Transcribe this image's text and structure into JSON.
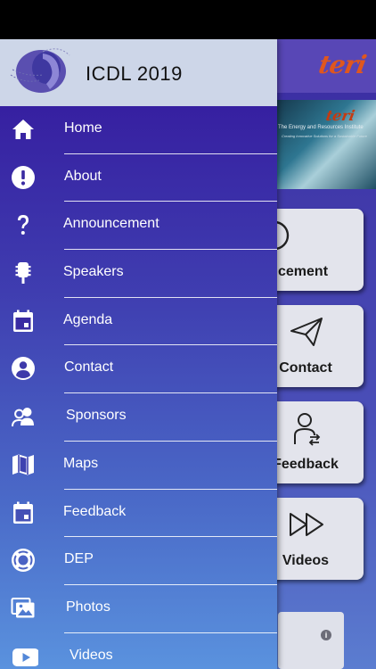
{
  "app": {
    "brand_logo_text": "teri",
    "banner": {
      "logo_text": "teri",
      "title": "The Energy and Resources Institute",
      "subtitle": "Creating Innovative Solutions for a Sustainable Future"
    },
    "tiles": [
      {
        "label": "cement",
        "icon": "megaphone-icon"
      },
      {
        "label": "Contact",
        "icon": "paper-plane-icon"
      },
      {
        "label": "Feedback",
        "icon": "feedback-person-icon"
      },
      {
        "label": "Videos",
        "icon": "fast-forward-icon"
      }
    ]
  },
  "drawer": {
    "title": "ICDL 2019",
    "items": [
      {
        "label": "Home",
        "icon": "home-icon"
      },
      {
        "label": "About",
        "icon": "info-exclamation-icon"
      },
      {
        "label": "Announcement",
        "icon": "question-mark-icon"
      },
      {
        "label": "Speakers",
        "icon": "microphone-icon"
      },
      {
        "label": "Agenda",
        "icon": "calendar-icon"
      },
      {
        "label": "Contact",
        "icon": "person-icon"
      },
      {
        "label": "Sponsors",
        "icon": "people-icon"
      },
      {
        "label": "Maps",
        "icon": "map-icon"
      },
      {
        "label": "Feedback",
        "icon": "calendar-icon"
      },
      {
        "label": "DEP",
        "icon": "lifebuoy-icon"
      },
      {
        "label": "Photos",
        "icon": "photos-icon"
      },
      {
        "label": "Videos",
        "icon": "youtube-icon"
      }
    ]
  },
  "colors": {
    "drawer_top": "#33159b",
    "drawer_bottom": "#5a92de",
    "drawer_header": "#cdd6e8",
    "brand_orange": "#e0571e"
  }
}
